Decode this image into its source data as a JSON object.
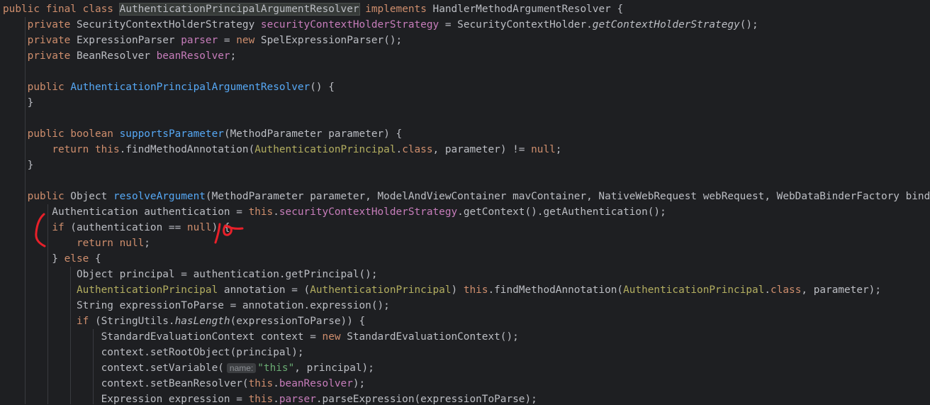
{
  "lines": [
    [
      [
        "public",
        "kw"
      ],
      [
        " "
      ],
      [
        "final",
        "kw"
      ],
      [
        " "
      ],
      [
        "class",
        "kw"
      ],
      [
        " "
      ],
      [
        "AuthenticationPrincipalArgumentResolver",
        "cls-hl"
      ],
      [
        " "
      ],
      [
        "implements",
        "kw"
      ],
      [
        " HandlerMethodArgumentResolver {"
      ]
    ],
    [
      [
        "    "
      ],
      [
        "private",
        "kw"
      ],
      [
        " SecurityContextHolderStrategy "
      ],
      [
        "securityContextHolderStrategy",
        "field"
      ],
      [
        " = SecurityContextHolder."
      ],
      [
        "getContextHolderStrategy",
        "ital"
      ],
      [
        "();"
      ]
    ],
    [
      [
        "    "
      ],
      [
        "private",
        "kw"
      ],
      [
        " ExpressionParser "
      ],
      [
        "parser",
        "field"
      ],
      [
        " = "
      ],
      [
        "new",
        "kw"
      ],
      [
        " SpelExpressionParser();"
      ]
    ],
    [
      [
        "    "
      ],
      [
        "private",
        "kw"
      ],
      [
        " BeanResolver "
      ],
      [
        "beanResolver",
        "field"
      ],
      [
        ";"
      ]
    ],
    [
      [
        ""
      ]
    ],
    [
      [
        "    "
      ],
      [
        "public",
        "kw"
      ],
      [
        " "
      ],
      [
        "AuthenticationPrincipalArgumentResolver",
        "fn"
      ],
      [
        "() {"
      ]
    ],
    [
      [
        "    }"
      ]
    ],
    [
      [
        ""
      ]
    ],
    [
      [
        "    "
      ],
      [
        "public",
        "kw"
      ],
      [
        " "
      ],
      [
        "boolean",
        "kw"
      ],
      [
        " "
      ],
      [
        "supportsParameter",
        "fn"
      ],
      [
        "(MethodParameter parameter) {"
      ]
    ],
    [
      [
        "        "
      ],
      [
        "return",
        "kw"
      ],
      [
        " "
      ],
      [
        "this",
        "kw"
      ],
      [
        ".findMethodAnnotation("
      ],
      [
        "AuthenticationPrincipal",
        "anno"
      ],
      [
        "."
      ],
      [
        "class",
        "kw"
      ],
      [
        ", parameter) != "
      ],
      [
        "null",
        "kw"
      ],
      [
        ";"
      ]
    ],
    [
      [
        "    }"
      ]
    ],
    [
      [
        ""
      ]
    ],
    [
      [
        "    "
      ],
      [
        "public",
        "kw"
      ],
      [
        " Object "
      ],
      [
        "resolveArgument",
        "fn"
      ],
      [
        "(MethodParameter parameter, ModelAndViewContainer mavContainer, NativeWebRequest webRequest, WebDataBinderFactory binderFactory) {"
      ]
    ],
    [
      [
        "        Authentication authentication = "
      ],
      [
        "this",
        "kw"
      ],
      [
        "."
      ],
      [
        "securityContextHolderStrategy",
        "field"
      ],
      [
        ".getContext().getAuthentication();"
      ]
    ],
    [
      [
        "        "
      ],
      [
        "if",
        "kw"
      ],
      [
        " (authentication == "
      ],
      [
        "null",
        "kw"
      ],
      [
        ") {"
      ]
    ],
    [
      [
        "            "
      ],
      [
        "return",
        "kw"
      ],
      [
        " "
      ],
      [
        "null",
        "kw"
      ],
      [
        ";"
      ]
    ],
    [
      [
        "        } "
      ],
      [
        "else",
        "kw"
      ],
      [
        " {"
      ]
    ],
    [
      [
        "            Object principal = authentication.getPrincipal();"
      ]
    ],
    [
      [
        "            "
      ],
      [
        "AuthenticationPrincipal",
        "anno"
      ],
      [
        " annotation = ("
      ],
      [
        "AuthenticationPrincipal",
        "anno"
      ],
      [
        ") "
      ],
      [
        "this",
        "kw"
      ],
      [
        ".findMethodAnnotation("
      ],
      [
        "AuthenticationPrincipal",
        "anno"
      ],
      [
        "."
      ],
      [
        "class",
        "kw"
      ],
      [
        ", parameter);"
      ]
    ],
    [
      [
        "            String expressionToParse = annotation.expression();"
      ]
    ],
    [
      [
        "            "
      ],
      [
        "if",
        "kw"
      ],
      [
        " (StringUtils."
      ],
      [
        "hasLength",
        "ital"
      ],
      [
        "(expressionToParse)) {"
      ]
    ],
    [
      [
        "                StandardEvaluationContext context = "
      ],
      [
        "new",
        "kw"
      ],
      [
        " StandardEvaluationContext();"
      ]
    ],
    [
      [
        "                context.setRootObject(principal);"
      ]
    ],
    [
      [
        "                context.setVariable("
      ],
      [
        "name:",
        "hint"
      ],
      [
        "\"this\"",
        "str"
      ],
      [
        ", principal);"
      ]
    ],
    [
      [
        "                context.setBeanResolver("
      ],
      [
        "this",
        "kw"
      ],
      [
        "."
      ],
      [
        "beanResolver",
        "field"
      ],
      [
        ");"
      ]
    ],
    [
      [
        "                Expression expression = "
      ],
      [
        "this",
        "kw"
      ],
      [
        "."
      ],
      [
        "parser",
        "field"
      ],
      [
        ".parseExpression(expressionToParse);"
      ]
    ]
  ],
  "annotation_color": "#e8202a"
}
